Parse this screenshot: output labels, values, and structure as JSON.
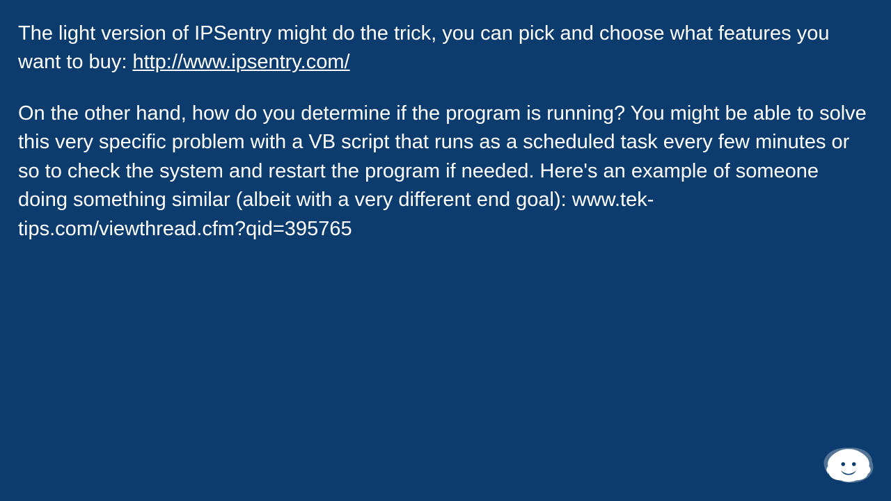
{
  "paragraphs": [
    {
      "before_link": "The light version of IPSentry might do the trick, you can pick and choose what features you want to buy: ",
      "link": "http://www.ipsentry.com/",
      "after_link": ""
    },
    {
      "text": "On the other hand, how do you determine if the program is running? You might be able to solve this very specific problem with a VB script that runs as a scheduled task every few minutes or so to check the system and restart the program if needed. Here's an example of someone doing something similar (albeit with a very different end goal): www.tek-tips.com/viewthread.cfm?qid=395765"
    }
  ]
}
